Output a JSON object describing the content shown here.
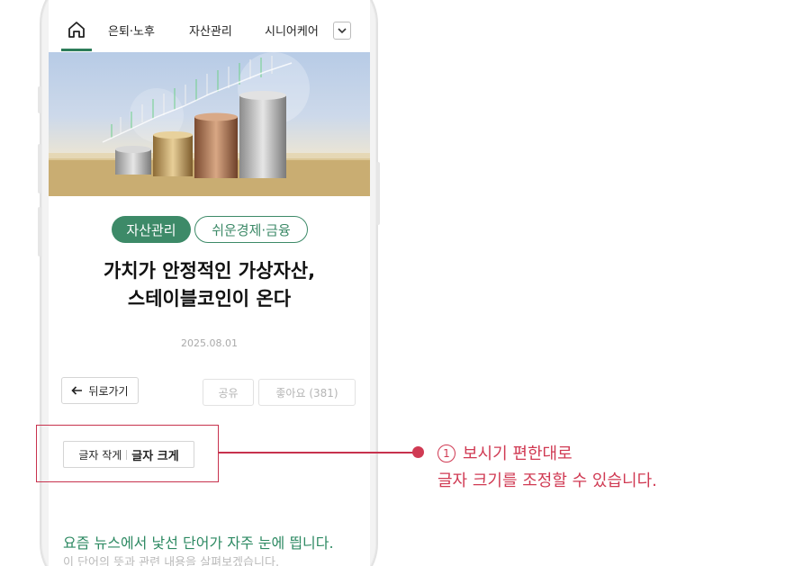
{
  "nav": {
    "tabs": [
      "은퇴·노후",
      "자산관리",
      "시니어케어"
    ],
    "home_icon": "home-icon",
    "dropdown_icon": "chevron-down-icon"
  },
  "article": {
    "categories": [
      "자산관리",
      "쉬운경제·금융"
    ],
    "title_line1": "가치가 안정적인 가상자산,",
    "title_line2": "스테이블코인이 온다",
    "date": "2025.08.01",
    "back_label": "뒤로가기",
    "share_label": "공유",
    "like_label": "좋아요 (381)",
    "font_small_label": "글자 작게",
    "font_large_label": "글자 크게",
    "body_first_line": "요즘 뉴스에서 낯선 단어가 자주 눈에 띕니다.",
    "body_second_line": "이 단어의 뜻과 관련 내용을 살펴보겠습니다."
  },
  "annotation": {
    "number": "1",
    "line1": "보시기 편한대로",
    "line2": "글자 크기를 조정할 수 있습니다."
  },
  "colors": {
    "accent_green": "#3d8a68",
    "annotation_red": "#d03a53"
  }
}
